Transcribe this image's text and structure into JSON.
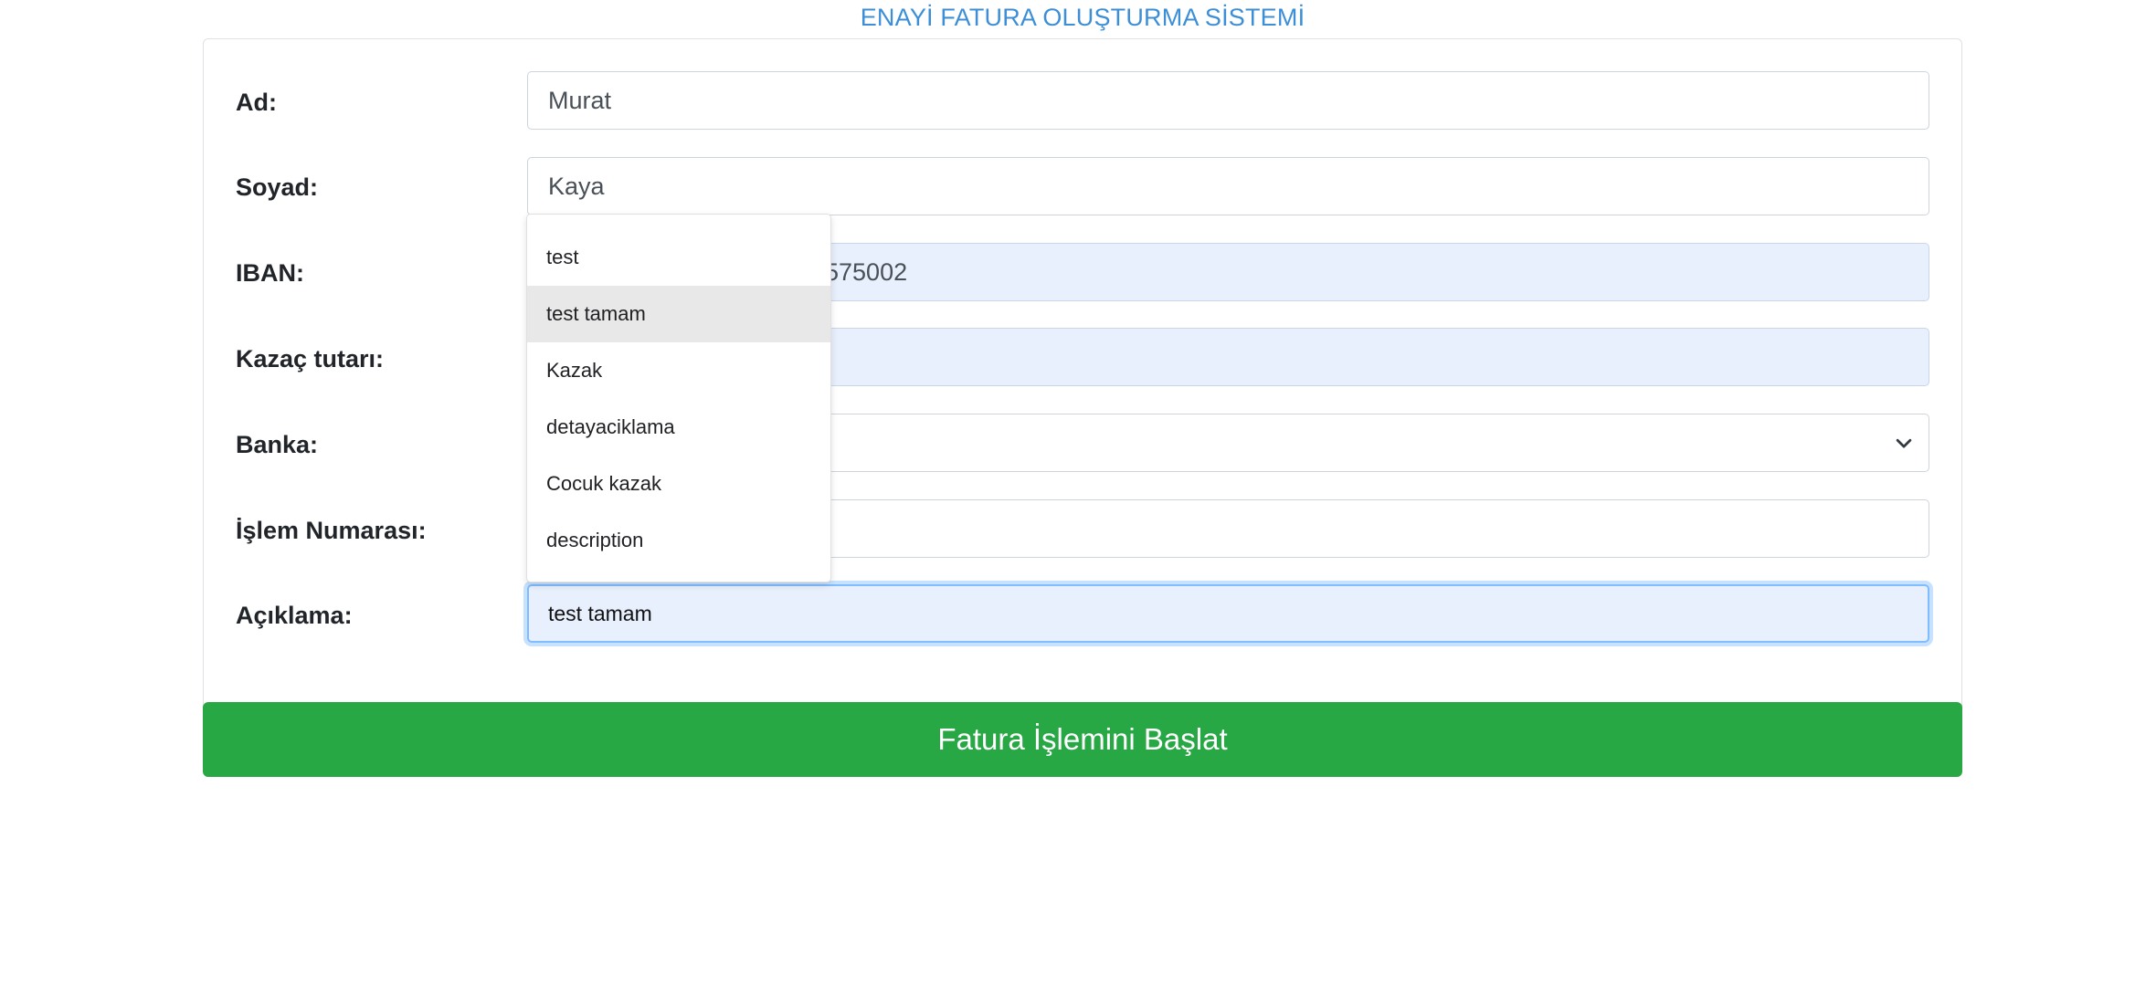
{
  "header": {
    "title": "ENAYİ FATURA OLUŞTURMA SİSTEMİ"
  },
  "form": {
    "fields": [
      {
        "label": "Ad:",
        "value": "Murat"
      },
      {
        "label": "Soyad:",
        "value": "Kaya"
      },
      {
        "label": "IBAN:",
        "value": "575002"
      },
      {
        "label": "Kazaç tutarı:",
        "value": ""
      },
      {
        "label": "Banka:",
        "value": ""
      },
      {
        "label": "İşlem Numarası:",
        "value": ""
      },
      {
        "label": "Açıklama:",
        "value": "test tamam"
      }
    ]
  },
  "autocomplete": {
    "items": [
      "test",
      "test tamam",
      "Kazak",
      "detayaciklama",
      "Cocuk kazak",
      "description"
    ],
    "highlighted": "test tamam"
  },
  "submit": {
    "label": "Fatura İşlemini Başlat"
  },
  "colors": {
    "title": "#3c8fd6",
    "submit_bg": "#28a745",
    "autofill_bg": "#e8f0fe",
    "focus_border": "#80bdff"
  },
  "icons": {
    "select_arrow": "chevron-down-icon"
  }
}
